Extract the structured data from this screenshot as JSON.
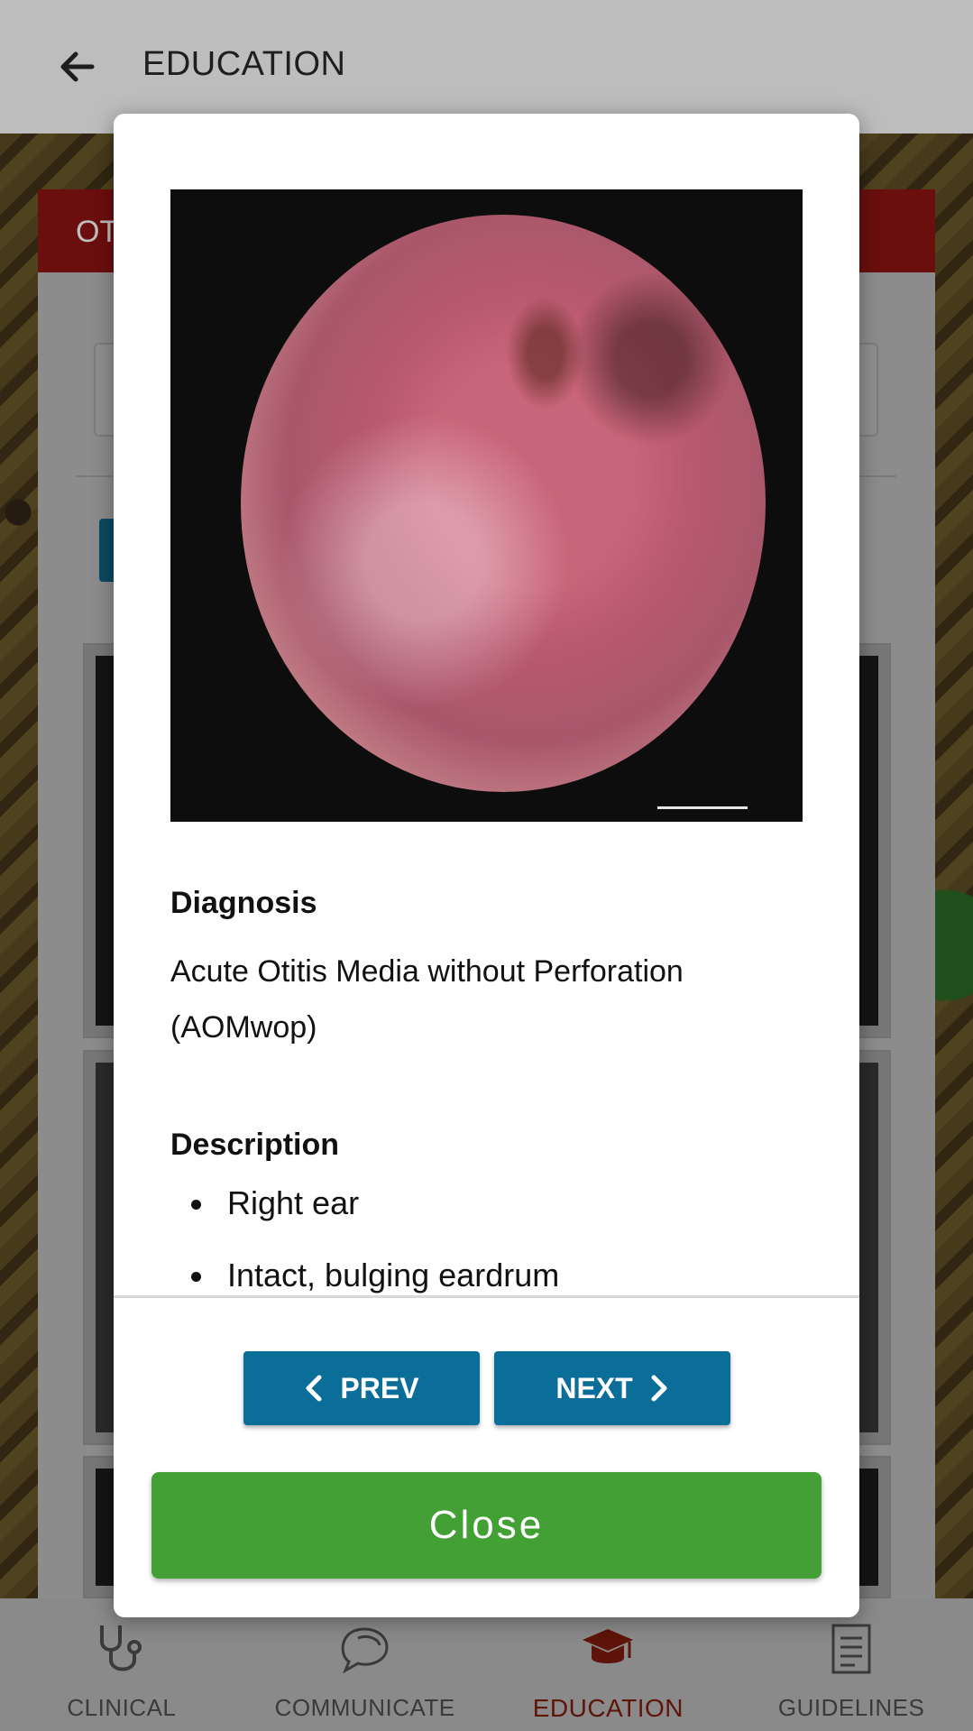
{
  "header": {
    "title": "EDUCATION"
  },
  "background": {
    "card_title": "OT"
  },
  "modal": {
    "diagnosis_title": "Diagnosis",
    "diagnosis_text": "Acute Otitis Media without Perforation (AOMwop)",
    "description_title": "Description",
    "description_items": [
      "Right ear",
      "Intact, bulging eardrum"
    ],
    "prev_label": "PREV",
    "next_label": "NEXT",
    "close_label": "Close"
  },
  "bottom_nav": {
    "items": [
      {
        "label": "CLINICAL",
        "icon": "stethoscope-icon"
      },
      {
        "label": "COMMUNICATE",
        "icon": "chat-bubbles-icon"
      },
      {
        "label": "EDUCATION",
        "icon": "graduation-cap-icon",
        "active": true
      },
      {
        "label": "GUIDELINES",
        "icon": "document-icon"
      }
    ]
  },
  "colors": {
    "primary_button": "#0a6e99",
    "close_button": "#43a035",
    "active_nav": "#5e1408",
    "header_red": "#6b0e0e"
  }
}
